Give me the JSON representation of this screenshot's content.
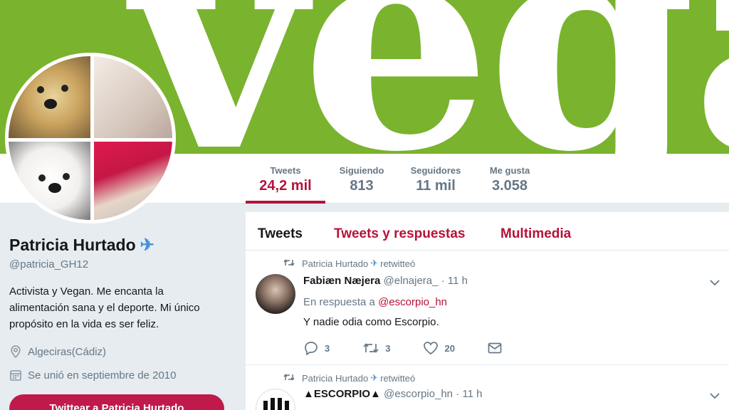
{
  "banner": {
    "text": "vega"
  },
  "stats": [
    {
      "label": "Tweets",
      "value": "24,2 mil",
      "active": true
    },
    {
      "label": "Siguiendo",
      "value": "813",
      "active": false
    },
    {
      "label": "Seguidores",
      "value": "11 mil",
      "active": false
    },
    {
      "label": "Me gusta",
      "value": "3.058",
      "active": false
    }
  ],
  "profile": {
    "name": "Patricia Hurtado",
    "name_emoji_icon": "airplane-icon",
    "handle": "@patricia_GH12",
    "bio": "Activista y Vegan. Me encanta la alimentación sana y el deporte. Mi único propósito en la vida es ser feliz.",
    "location": "Algeciras(Cádiz)",
    "joined": "Se unió en septiembre de 2010",
    "tweet_to_button": "Twittear a Patricia Hurtado"
  },
  "tabs": [
    {
      "label": "Tweets",
      "active": true
    },
    {
      "label": "Tweets y respuestas",
      "active": false
    },
    {
      "label": "Multimedia",
      "active": false
    }
  ],
  "tweets": [
    {
      "retweeted_by": "Patricia Hurtado",
      "retweet_suffix": "retwitteó",
      "author": "Fabiæn Næjera",
      "handle": "@elnajera_",
      "time": "11 h",
      "reply_prefix": "En respuesta a",
      "reply_to": "@escorpio_hn",
      "text": "Y nadie odia como Escorpio.",
      "replies": "3",
      "retweets": "3",
      "likes": "20"
    },
    {
      "retweeted_by": "Patricia Hurtado",
      "retweet_suffix": "retwitteó",
      "author": "▲ESCORPIO▲",
      "handle": "@escorpio_hn",
      "time": "11 h"
    }
  ],
  "colors": {
    "banner_green": "#7ab32e",
    "accent": "#b6123a",
    "button": "#c01a4d",
    "muted": "#657786"
  }
}
